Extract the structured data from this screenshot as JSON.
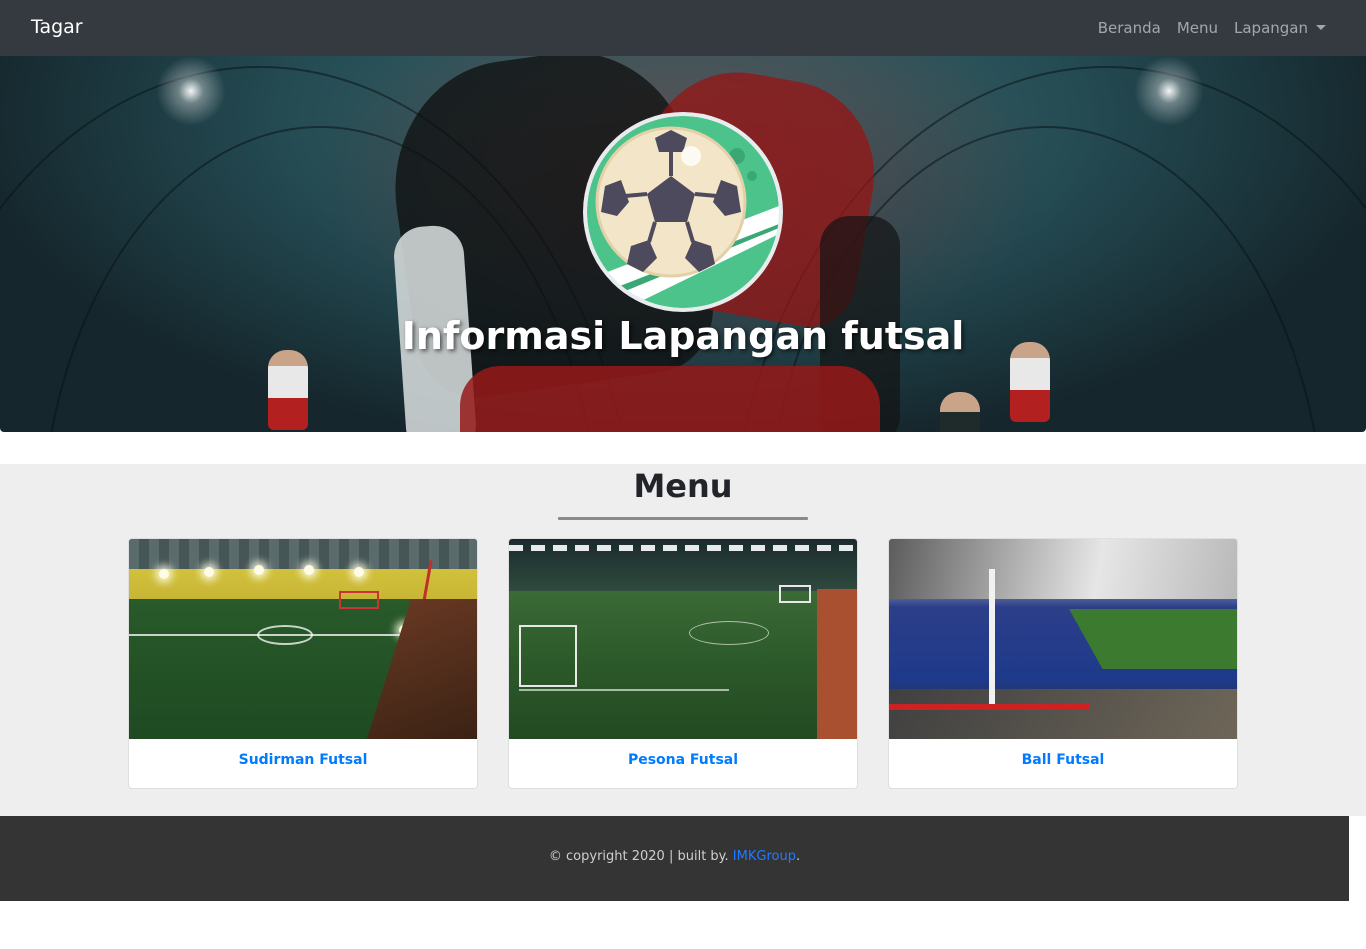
{
  "navbar": {
    "brand": "Tagar",
    "links": {
      "home": "Beranda",
      "menu": "Menu",
      "fields": "Lapangan"
    }
  },
  "hero": {
    "title": "Informasi Lapangan futsal"
  },
  "menu_section": {
    "title": "Menu",
    "cards": [
      {
        "title": "Sudirman Futsal"
      },
      {
        "title": "Pesona Futsal"
      },
      {
        "title": "Ball Futsal"
      }
    ]
  },
  "footer": {
    "text": "© copyright 2020 | built by.",
    "link_text": "IMKGroup",
    "suffix": "."
  },
  "colors": {
    "navbar_bg": "#343a40",
    "link_blue": "#007bff",
    "section_bg": "#eeeeee",
    "footer_bg": "#343434",
    "logo_green": "#4cc38a"
  },
  "icons": {
    "logo": "soccer-ball-logo",
    "dropdown": "caret-down-icon"
  }
}
